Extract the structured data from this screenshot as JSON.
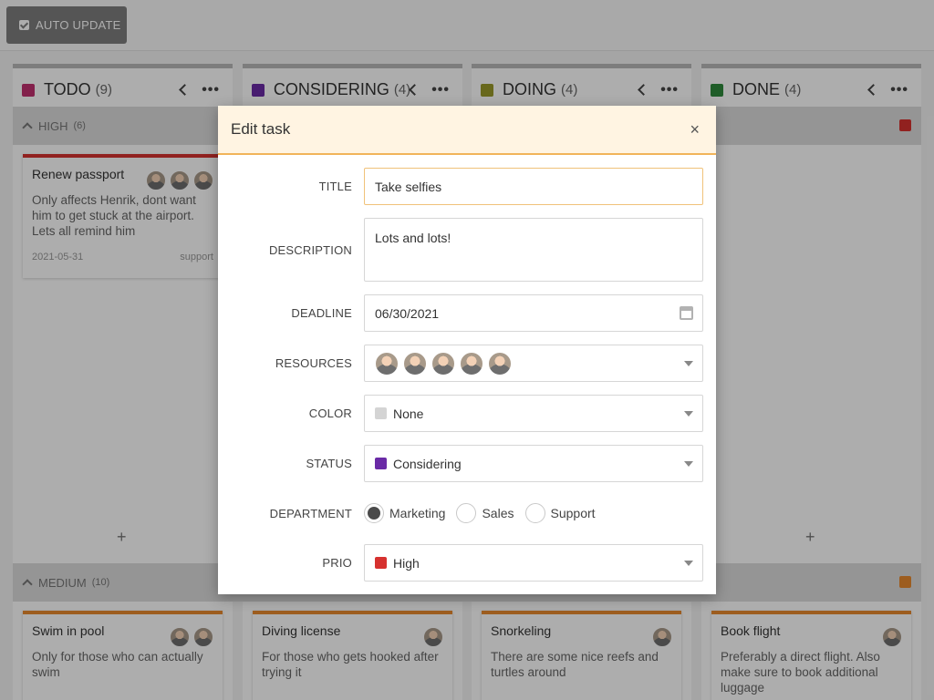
{
  "toolbar": {
    "auto_update_label": "AUTO UPDATE"
  },
  "columns": [
    {
      "name": "TODO",
      "count": "(9)",
      "color": "#c2306f"
    },
    {
      "name": "CONSIDERING",
      "count": "(4)",
      "color": "#6a2aa6"
    },
    {
      "name": "DOING",
      "count": "(4)",
      "color": "#9a9a2a"
    },
    {
      "name": "DONE",
      "count": "(4)",
      "color": "#2f8a3c"
    }
  ],
  "swimlanes": [
    {
      "name": "HIGH",
      "count": "(6)",
      "color": "#d6312f"
    },
    {
      "name": "MEDIUM",
      "count": "(10)",
      "color": "#e88a2e"
    }
  ],
  "cards": {
    "renew": {
      "title": "Renew passport",
      "desc": "Only affects Henrik, dont want him to get stuck at the airport. Lets all remind him",
      "date": "2021-05-31",
      "tag": "support"
    },
    "swim": {
      "title": "Swim in pool",
      "desc": "Only for those who can actually swim"
    },
    "diving": {
      "title": "Diving license",
      "desc": "For those who gets hooked after trying it"
    },
    "snorkel": {
      "title": "Snorkeling",
      "desc": "There are some nice reefs and turtles around"
    },
    "flight": {
      "title": "Book flight",
      "desc": "Preferably a direct flight. Also make sure to book additional luggage"
    }
  },
  "add_glyph": "+",
  "dialog": {
    "title": "Edit task",
    "close": "×",
    "labels": {
      "title": "TITLE",
      "description": "DESCRIPTION",
      "deadline": "DEADLINE",
      "resources": "RESOURCES",
      "color": "COLOR",
      "status": "STATUS",
      "department": "DEPARTMENT",
      "prio": "PRIO"
    },
    "values": {
      "title": "Take selfies",
      "description": "Lots and lots!",
      "deadline": "06/30/2021",
      "color": "None",
      "color_swatch": "#d4d4d4",
      "status": "Considering",
      "status_swatch": "#6a2aa6",
      "prio": "High",
      "prio_swatch": "#d6312f"
    },
    "departments": [
      "Marketing",
      "Sales",
      "Support"
    ],
    "department_selected": "Marketing",
    "icons": {
      "deadline": "calendar-icon",
      "dropdown": "chevron-down-icon",
      "close": "close-icon"
    }
  }
}
